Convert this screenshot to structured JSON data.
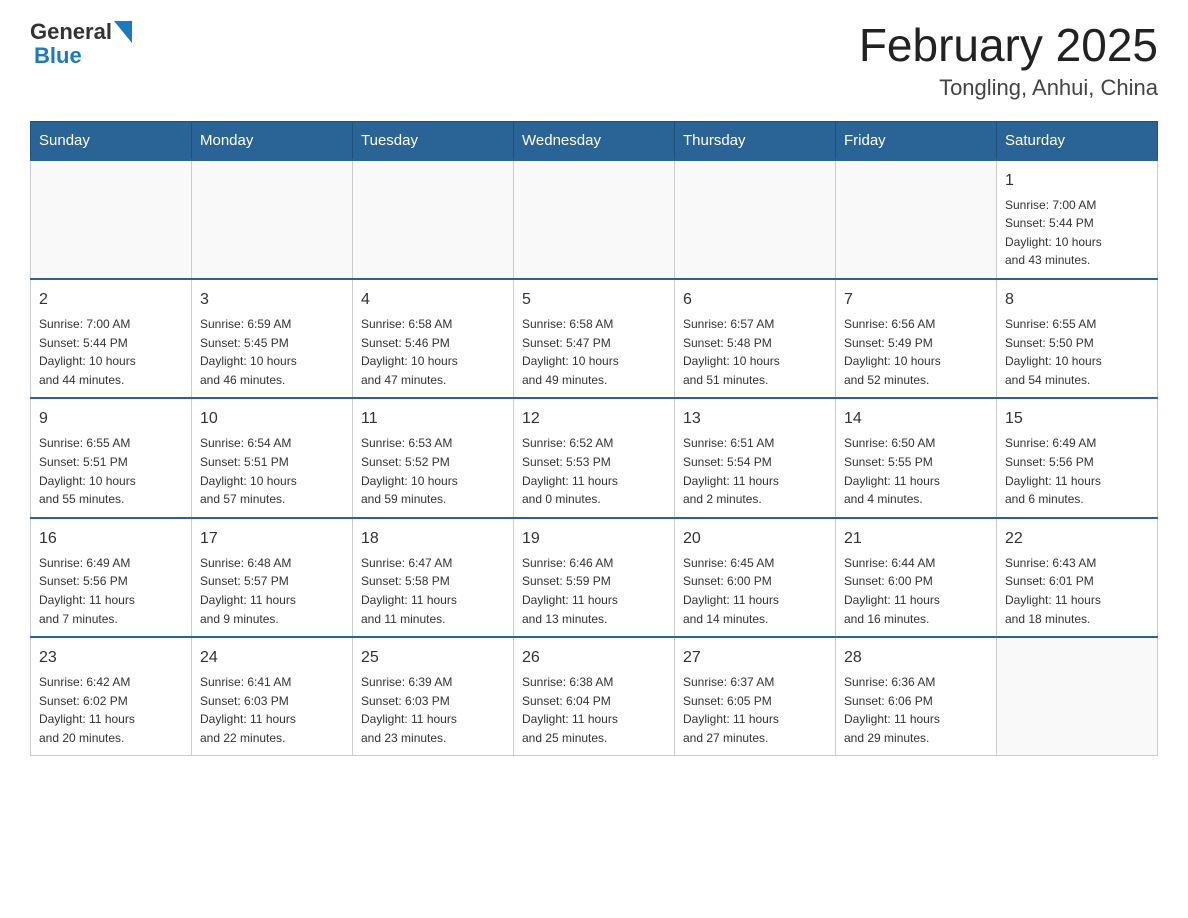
{
  "header": {
    "logo_general": "General",
    "logo_blue": "Blue",
    "month": "February 2025",
    "location": "Tongling, Anhui, China"
  },
  "weekdays": [
    "Sunday",
    "Monday",
    "Tuesday",
    "Wednesday",
    "Thursday",
    "Friday",
    "Saturday"
  ],
  "weeks": [
    {
      "days": [
        {
          "number": "",
          "info": ""
        },
        {
          "number": "",
          "info": ""
        },
        {
          "number": "",
          "info": ""
        },
        {
          "number": "",
          "info": ""
        },
        {
          "number": "",
          "info": ""
        },
        {
          "number": "",
          "info": ""
        },
        {
          "number": "1",
          "info": "Sunrise: 7:00 AM\nSunset: 5:44 PM\nDaylight: 10 hours\nand 43 minutes."
        }
      ]
    },
    {
      "days": [
        {
          "number": "2",
          "info": "Sunrise: 7:00 AM\nSunset: 5:44 PM\nDaylight: 10 hours\nand 44 minutes."
        },
        {
          "number": "3",
          "info": "Sunrise: 6:59 AM\nSunset: 5:45 PM\nDaylight: 10 hours\nand 46 minutes."
        },
        {
          "number": "4",
          "info": "Sunrise: 6:58 AM\nSunset: 5:46 PM\nDaylight: 10 hours\nand 47 minutes."
        },
        {
          "number": "5",
          "info": "Sunrise: 6:58 AM\nSunset: 5:47 PM\nDaylight: 10 hours\nand 49 minutes."
        },
        {
          "number": "6",
          "info": "Sunrise: 6:57 AM\nSunset: 5:48 PM\nDaylight: 10 hours\nand 51 minutes."
        },
        {
          "number": "7",
          "info": "Sunrise: 6:56 AM\nSunset: 5:49 PM\nDaylight: 10 hours\nand 52 minutes."
        },
        {
          "number": "8",
          "info": "Sunrise: 6:55 AM\nSunset: 5:50 PM\nDaylight: 10 hours\nand 54 minutes."
        }
      ]
    },
    {
      "days": [
        {
          "number": "9",
          "info": "Sunrise: 6:55 AM\nSunset: 5:51 PM\nDaylight: 10 hours\nand 55 minutes."
        },
        {
          "number": "10",
          "info": "Sunrise: 6:54 AM\nSunset: 5:51 PM\nDaylight: 10 hours\nand 57 minutes."
        },
        {
          "number": "11",
          "info": "Sunrise: 6:53 AM\nSunset: 5:52 PM\nDaylight: 10 hours\nand 59 minutes."
        },
        {
          "number": "12",
          "info": "Sunrise: 6:52 AM\nSunset: 5:53 PM\nDaylight: 11 hours\nand 0 minutes."
        },
        {
          "number": "13",
          "info": "Sunrise: 6:51 AM\nSunset: 5:54 PM\nDaylight: 11 hours\nand 2 minutes."
        },
        {
          "number": "14",
          "info": "Sunrise: 6:50 AM\nSunset: 5:55 PM\nDaylight: 11 hours\nand 4 minutes."
        },
        {
          "number": "15",
          "info": "Sunrise: 6:49 AM\nSunset: 5:56 PM\nDaylight: 11 hours\nand 6 minutes."
        }
      ]
    },
    {
      "days": [
        {
          "number": "16",
          "info": "Sunrise: 6:49 AM\nSunset: 5:56 PM\nDaylight: 11 hours\nand 7 minutes."
        },
        {
          "number": "17",
          "info": "Sunrise: 6:48 AM\nSunset: 5:57 PM\nDaylight: 11 hours\nand 9 minutes."
        },
        {
          "number": "18",
          "info": "Sunrise: 6:47 AM\nSunset: 5:58 PM\nDaylight: 11 hours\nand 11 minutes."
        },
        {
          "number": "19",
          "info": "Sunrise: 6:46 AM\nSunset: 5:59 PM\nDaylight: 11 hours\nand 13 minutes."
        },
        {
          "number": "20",
          "info": "Sunrise: 6:45 AM\nSunset: 6:00 PM\nDaylight: 11 hours\nand 14 minutes."
        },
        {
          "number": "21",
          "info": "Sunrise: 6:44 AM\nSunset: 6:00 PM\nDaylight: 11 hours\nand 16 minutes."
        },
        {
          "number": "22",
          "info": "Sunrise: 6:43 AM\nSunset: 6:01 PM\nDaylight: 11 hours\nand 18 minutes."
        }
      ]
    },
    {
      "days": [
        {
          "number": "23",
          "info": "Sunrise: 6:42 AM\nSunset: 6:02 PM\nDaylight: 11 hours\nand 20 minutes."
        },
        {
          "number": "24",
          "info": "Sunrise: 6:41 AM\nSunset: 6:03 PM\nDaylight: 11 hours\nand 22 minutes."
        },
        {
          "number": "25",
          "info": "Sunrise: 6:39 AM\nSunset: 6:03 PM\nDaylight: 11 hours\nand 23 minutes."
        },
        {
          "number": "26",
          "info": "Sunrise: 6:38 AM\nSunset: 6:04 PM\nDaylight: 11 hours\nand 25 minutes."
        },
        {
          "number": "27",
          "info": "Sunrise: 6:37 AM\nSunset: 6:05 PM\nDaylight: 11 hours\nand 27 minutes."
        },
        {
          "number": "28",
          "info": "Sunrise: 6:36 AM\nSunset: 6:06 PM\nDaylight: 11 hours\nand 29 minutes."
        },
        {
          "number": "",
          "info": ""
        }
      ]
    }
  ]
}
